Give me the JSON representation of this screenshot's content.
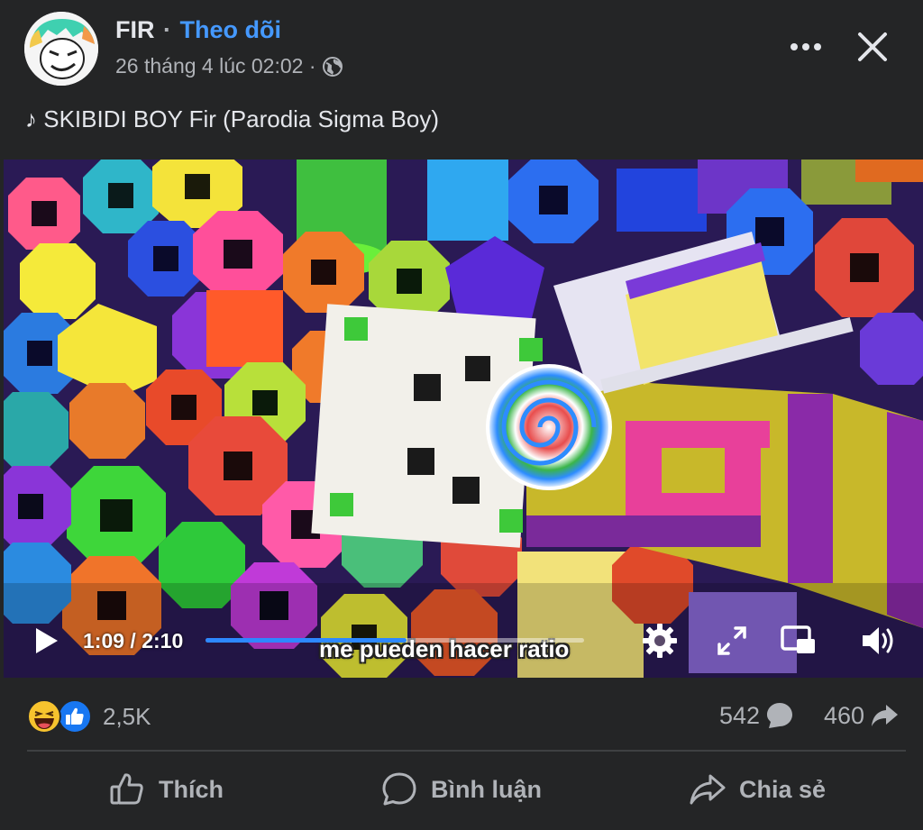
{
  "post": {
    "author": "FIR",
    "separator": "·",
    "follow_label": "Theo dõi",
    "timestamp": "26 tháng 4 lúc 02:02 ·",
    "caption": "♪ SKIBIDI BOY   Fir (Parodia Sigma Boy)"
  },
  "video": {
    "subtitle": "me pueden hacer ratio",
    "time_display": "1:09 / 2:10",
    "progress": 0.53
  },
  "stats": {
    "reaction_count": "2,5K",
    "comment_count": "542",
    "share_count": "460"
  },
  "actions": {
    "like_label": "Thích",
    "comment_label": "Bình luận",
    "share_label": "Chia sẻ"
  },
  "icons": {
    "more": "more-icon",
    "close": "close-icon",
    "globe": "globe-icon",
    "play": "play-icon",
    "settings": "gear-icon",
    "fullscreen": "fullscreen-icon",
    "pip": "picture-in-picture-icon",
    "volume": "volume-icon",
    "haha": "haha-reaction-icon",
    "like": "like-reaction-icon"
  },
  "colors": {
    "background": "#242526",
    "accent": "#4599ff",
    "progress": "#2d88ff",
    "text_secondary": "#b0b3b8"
  }
}
